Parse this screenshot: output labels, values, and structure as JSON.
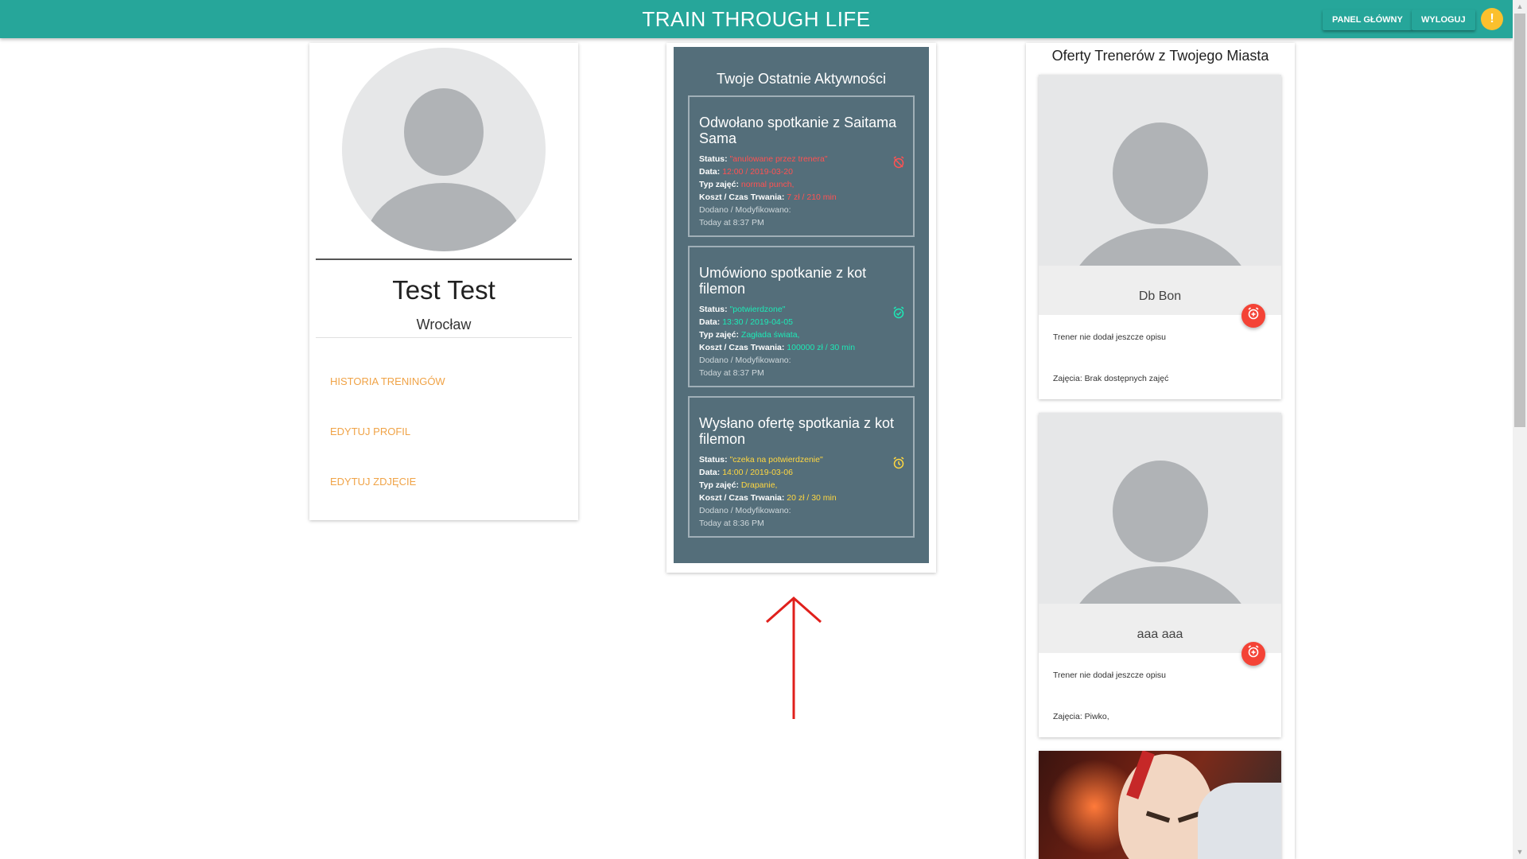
{
  "header": {
    "title": "TRAIN THROUGH LIFE",
    "buttons": {
      "dashboard": "PANEL GŁÓWNY",
      "logout": "WYLOGUJ"
    },
    "info_icon": "!",
    "accent_color": "#26a69a"
  },
  "profile": {
    "name": "Test Test",
    "city": "Wrocław",
    "links": [
      "HISTORIA TRENINGÓW",
      "EDYTUJ PROFIL",
      "EDYTUJ ZDJĘCIE"
    ]
  },
  "activities": {
    "title": "Twoje Ostatnie Aktywności",
    "labels": {
      "status": "Status:",
      "date": "Data:",
      "type": "Typ zajęć:",
      "cost": "Koszt / Czas Trwania:",
      "added": "Dodano / Modyfikowano:"
    },
    "items": [
      {
        "heading": "Odwołano spotkanie z Saitama Sama",
        "status": "\"anulowane przez trenera\"",
        "date": "12:00 / 2019-03-20",
        "type": "normal punch,",
        "cost": "7 zł / 210 min",
        "modified": "Today at 8:37 PM",
        "color": "#ff5252",
        "icon": "alarm-off-icon"
      },
      {
        "heading": "Umówiono spotkanie z kot filemon",
        "status": "\"potwierdzone\"",
        "date": "13:30 / 2019-04-05",
        "type": "Zagłada świata,",
        "cost": "100000 zł / 30 min",
        "modified": "Today at 8:37 PM",
        "color": "#1de9b6",
        "icon": "alarm-check-icon"
      },
      {
        "heading": "Wysłano ofertę spotkania z kot filemon",
        "status": "\"czeka na potwierdzenie\"",
        "date": "14:00 / 2019-03-06",
        "type": "Drapanie,",
        "cost": "20 zł / 30 min",
        "modified": "Today at 8:36 PM",
        "color": "#ffd740",
        "icon": "alarm-icon"
      }
    ]
  },
  "trainers": {
    "title": "Oferty Trenerów z Twojego Miasta",
    "items": [
      {
        "name": "Db Bon",
        "description": "Trener nie dodał jeszcze opisu",
        "classes": "Zajęcia: Brak dostępnych zajęć"
      },
      {
        "name": "aaa aaa",
        "description": "Trener nie dodał jeszcze opisu",
        "classes": "Zajęcia: Piwko,"
      }
    ]
  }
}
